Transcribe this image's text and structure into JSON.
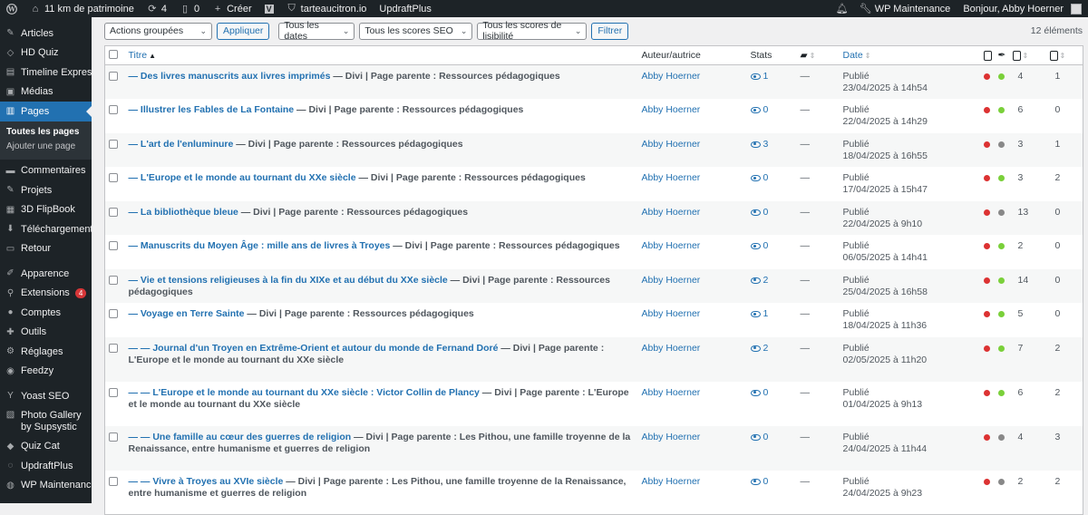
{
  "adminbar": {
    "site": "11 km de patrimoine",
    "updates": "4",
    "comments": "0",
    "new": "Créer",
    "plugin_v": "V",
    "tarteaucitron": "tarteaucitron.io",
    "updraft": "UpdraftPlus",
    "maintenance": "WP Maintenance",
    "greeting": "Bonjour, Abby Hoerner"
  },
  "sidebar": {
    "items": [
      {
        "label": "Articles",
        "icon": "pin-icon"
      },
      {
        "label": "HD Quiz",
        "icon": "quiz-icon"
      },
      {
        "label": "Timeline Express",
        "icon": "timeline-icon"
      },
      {
        "label": "Médias",
        "icon": "media-icon"
      },
      {
        "label": "Pages",
        "icon": "pages-icon"
      },
      {
        "label": "Commentaires",
        "icon": "comment-icon"
      },
      {
        "label": "Projets",
        "icon": "pin-icon"
      },
      {
        "label": "3D FlipBook",
        "icon": "book-icon"
      },
      {
        "label": "Téléchargements",
        "icon": "download-icon"
      },
      {
        "label": "Retour",
        "icon": "feedback-icon"
      },
      {
        "label": "Apparence",
        "icon": "brush-icon"
      },
      {
        "label": "Extensions",
        "icon": "plugin-icon",
        "badge": "4"
      },
      {
        "label": "Comptes",
        "icon": "users-icon"
      },
      {
        "label": "Outils",
        "icon": "tools-icon"
      },
      {
        "label": "Réglages",
        "icon": "settings-icon"
      },
      {
        "label": "Feedzy",
        "icon": "feedzy-icon"
      },
      {
        "label": "Yoast SEO",
        "icon": "yoast-icon"
      },
      {
        "label": "Photo Gallery by Supsystic",
        "icon": "gallery-icon"
      },
      {
        "label": "Quiz Cat",
        "icon": "quizcat-icon"
      },
      {
        "label": "UpdraftPlus",
        "icon": "updraft-icon"
      },
      {
        "label": "WP Maintenance",
        "icon": "maintenance-icon"
      }
    ],
    "submenu": [
      "Toutes les pages",
      "Ajouter une page"
    ]
  },
  "toolbar": {
    "bulk": "Actions groupées",
    "apply": "Appliquer",
    "dates": "Tous les dates",
    "seo": "Tous les scores SEO",
    "readability": "Tous les scores de lisibilité",
    "filter": "Filtrer",
    "count": "12 éléments"
  },
  "columns": {
    "title": "Titre",
    "author": "Auteur/autrice",
    "stats": "Stats",
    "date": "Date"
  },
  "rows": [
    {
      "title": "— Des livres manuscrits aux livres imprimés",
      "state": " — Divi | Page parente : Ressources pédagogiques",
      "author": "Abby Hoerner",
      "stats": "1",
      "comments": "—",
      "status": "Publié",
      "date": "23/04/2025 à 14h54",
      "seo": "red",
      "read": "green",
      "links": "4",
      "inlinks": "1"
    },
    {
      "title": "— Illustrer les Fables de La Fontaine",
      "state": " — Divi | Page parente : Ressources pédagogiques",
      "author": "Abby Hoerner",
      "stats": "0",
      "comments": "—",
      "status": "Publié",
      "date": "22/04/2025 à 14h29",
      "seo": "red",
      "read": "green",
      "links": "6",
      "inlinks": "0"
    },
    {
      "title": "— L'art de l'enluminure",
      "state": " — Divi | Page parente : Ressources pédagogiques",
      "author": "Abby Hoerner",
      "stats": "3",
      "comments": "—",
      "status": "Publié",
      "date": "18/04/2025 à 16h55",
      "seo": "red",
      "read": "gray",
      "links": "3",
      "inlinks": "1"
    },
    {
      "title": "— L'Europe et le monde au tournant du XXe siècle",
      "state": " — Divi | Page parente : Ressources pédagogiques",
      "author": "Abby Hoerner",
      "stats": "0",
      "comments": "—",
      "status": "Publié",
      "date": "17/04/2025 à 15h47",
      "seo": "red",
      "read": "green",
      "links": "3",
      "inlinks": "2"
    },
    {
      "title": "— La bibliothèque bleue",
      "state": " — Divi | Page parente : Ressources pédagogiques",
      "author": "Abby Hoerner",
      "stats": "0",
      "comments": "—",
      "status": "Publié",
      "date": "22/04/2025 à 9h10",
      "seo": "red",
      "read": "gray",
      "links": "13",
      "inlinks": "0"
    },
    {
      "title": "— Manuscrits du Moyen Âge : mille ans de livres à Troyes",
      "state": " — Divi | Page parente : Ressources pédagogiques",
      "author": "Abby Hoerner",
      "stats": "0",
      "comments": "—",
      "status": "Publié",
      "date": "06/05/2025 à 14h41",
      "seo": "red",
      "read": "green",
      "links": "2",
      "inlinks": "0"
    },
    {
      "title": "— Vie et tensions religieuses à la fin du XIXe et au début du XXe siècle",
      "state": " — Divi | Page parente : Ressources pédagogiques",
      "author": "Abby Hoerner",
      "stats": "2",
      "comments": "—",
      "status": "Publié",
      "date": "25/04/2025 à 16h58",
      "seo": "red",
      "read": "green",
      "links": "14",
      "inlinks": "0"
    },
    {
      "title": "— Voyage en Terre Sainte",
      "state": " — Divi | Page parente : Ressources pédagogiques",
      "author": "Abby Hoerner",
      "stats": "1",
      "comments": "—",
      "status": "Publié",
      "date": "18/04/2025 à 11h36",
      "seo": "red",
      "read": "green",
      "links": "5",
      "inlinks": "0"
    },
    {
      "title": "— — Journal d'un Troyen en Extrême-Orient et autour du monde de Fernand Doré",
      "state": " — Divi | Page parente : L'Europe et le monde au tournant du XXe siècle",
      "author": "Abby Hoerner",
      "stats": "2",
      "comments": "—",
      "status": "Publié",
      "date": "02/05/2025 à 11h20",
      "seo": "red",
      "read": "green",
      "links": "7",
      "inlinks": "2",
      "two": true
    },
    {
      "title": "— — L'Europe et le monde au tournant du XXe siècle : Victor Collin de Plancy",
      "state": " — Divi | Page parente : L'Europe et le monde au tournant du XXe siècle",
      "author": "Abby Hoerner",
      "stats": "0",
      "comments": "—",
      "status": "Publié",
      "date": "01/04/2025 à 9h13",
      "seo": "red",
      "read": "green",
      "links": "6",
      "inlinks": "2",
      "two": true
    },
    {
      "title": "— — Une famille au cœur des guerres de religion",
      "state": " — Divi | Page parente : Les Pithou, une famille troyenne de la Renaissance, entre humanisme et guerres de religion",
      "author": "Abby Hoerner",
      "stats": "0",
      "comments": "—",
      "status": "Publié",
      "date": "24/04/2025 à 11h44",
      "seo": "red",
      "read": "gray",
      "links": "4",
      "inlinks": "3",
      "two": true
    },
    {
      "title": "— — Vivre à Troyes au XVIe siècle",
      "state": " — Divi | Page parente : Les Pithou, une famille troyenne de la Renaissance, entre humanisme et guerres de religion",
      "author": "Abby Hoerner",
      "stats": "0",
      "comments": "—",
      "status": "Publié",
      "date": "24/04/2025 à 9h23",
      "seo": "red",
      "read": "gray",
      "links": "2",
      "inlinks": "2",
      "two": true
    }
  ]
}
